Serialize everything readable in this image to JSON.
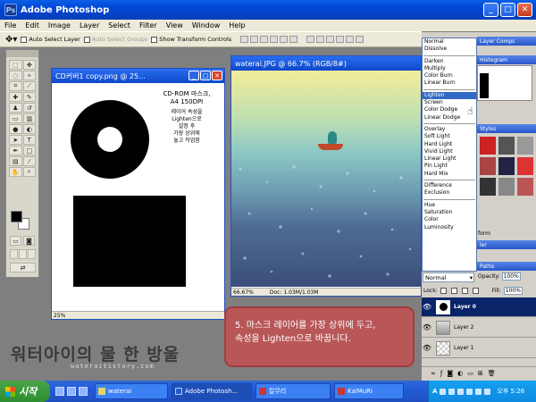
{
  "app": {
    "title": "Adobe Photoshop",
    "icon": "photoshop-icon"
  },
  "window_buttons": {
    "minimize": "_",
    "maximize": "□",
    "close": "✕"
  },
  "menu": [
    "File",
    "Edit",
    "Image",
    "Layer",
    "Select",
    "Filter",
    "View",
    "Window",
    "Help"
  ],
  "options": {
    "auto_select_layer": "Auto Select Layer",
    "auto_select_groups": "Auto Select Groups",
    "show_transform_controls": "Show Transform Controls"
  },
  "doc1": {
    "title": "CD커버1 copy.png @ 25...",
    "zoom": "25%",
    "text": {
      "l1": "CD-ROM 마스크,",
      "l2": "A4 150DPI",
      "l3": "레이어 속성을",
      "l4": "Lighten으로",
      "l5": "설정 후",
      "l6": "가장 상위에",
      "l7": "놓고 작업함"
    }
  },
  "doc2": {
    "title": "waterai.JPG @ 66.7% (RGB/8#)",
    "zoom": "66.67%",
    "doc_size": "Doc: 1.03M/1.03M"
  },
  "blend_modes": {
    "group1": [
      "Normal",
      "Dissolve"
    ],
    "group2": [
      "Darken",
      "Multiply",
      "Color Burn",
      "Linear Burn"
    ],
    "group3": [
      "Lighten",
      "Screen",
      "Color Dodge",
      "Linear Dodge"
    ],
    "group4": [
      "Overlay",
      "Soft Light",
      "Hard Light",
      "Vivid Light",
      "Linear Light",
      "Pin Light",
      "Hard Mix"
    ],
    "group5": [
      "Difference",
      "Exclusion"
    ],
    "group6": [
      "Hue",
      "Saturation",
      "Color",
      "Luminosity"
    ],
    "selected": "Lighten"
  },
  "palettes": {
    "layer_comps_tab": "Layer Comps",
    "histogram_tab": "Histogram",
    "styles_tab": "Styles",
    "paths_tab": "Paths",
    "layer_label_partial": "ler",
    "layer_label_partial2": "form",
    "blend_select": "Normal",
    "opacity_label": "Opacity:",
    "opacity_value": "100%",
    "lock_label": "Lock:",
    "fill_label": "Fill:",
    "fill_value": "100%"
  },
  "layers": [
    {
      "name": "Layer 0"
    },
    {
      "name": "Layer 2"
    },
    {
      "name": "Layer 1"
    }
  ],
  "caption": {
    "line1": "5. 마스크 레이어를 가장 상위에 두고,",
    "line2": "속성을 Lighten으로 바꿉니다."
  },
  "watermark": {
    "title": "워터아이의 물 한 방울",
    "url": "wateraitistory.com"
  },
  "taskbar": {
    "start": "시작",
    "tasks": [
      "waterai",
      "Adobe Photosh...",
      "칼무리",
      "KalMuRi"
    ],
    "lang": "A",
    "time": "오후 5:26"
  }
}
